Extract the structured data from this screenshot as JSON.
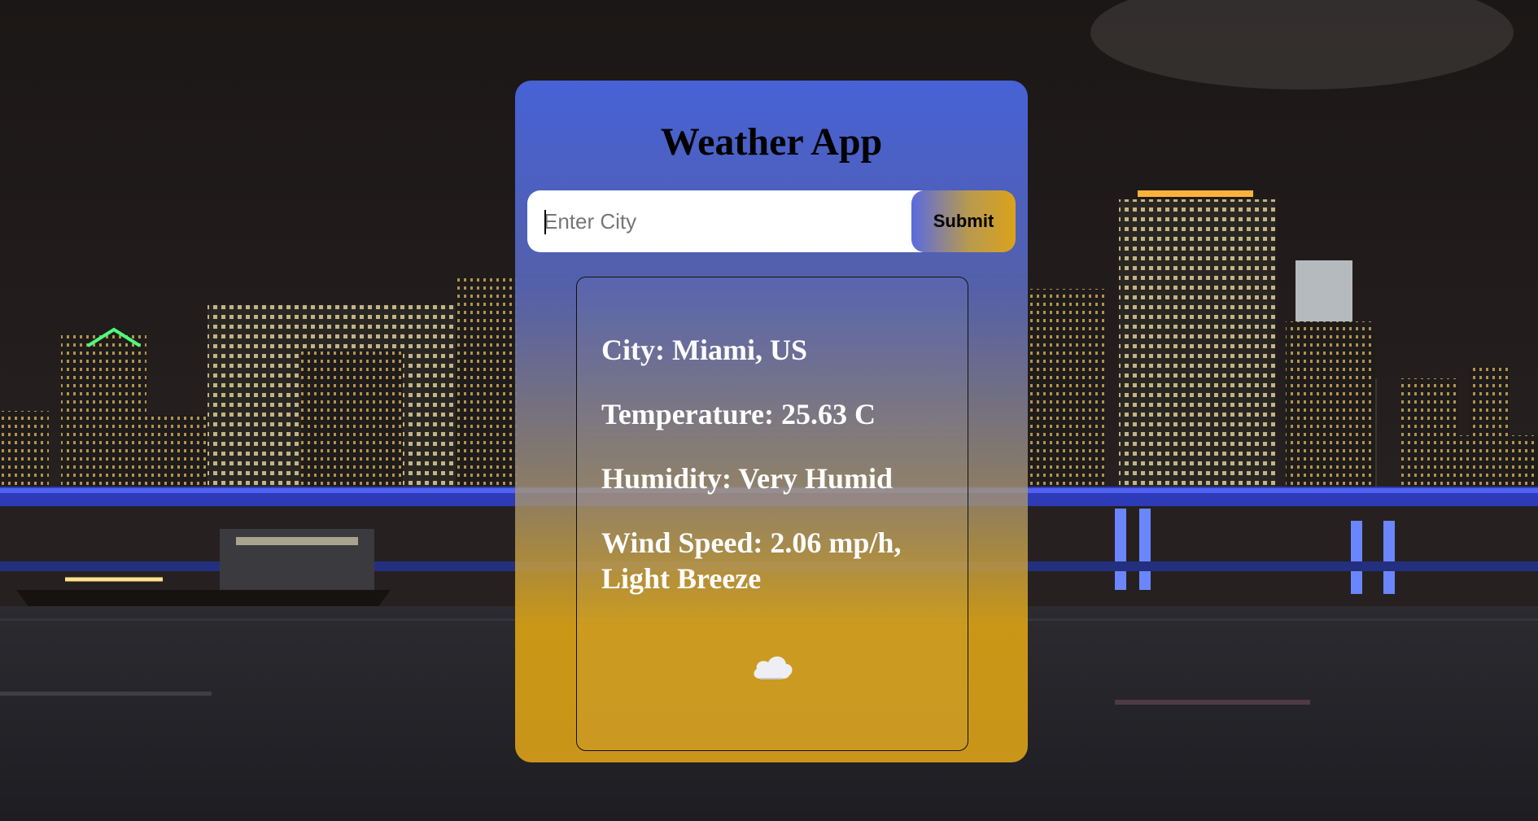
{
  "app": {
    "title": "Weather App"
  },
  "search": {
    "placeholder": "Enter City",
    "value": "",
    "submit_label": "Submit"
  },
  "weather": {
    "city_line": "City: Miami, US",
    "temperature_line": "Temperature: 25.63 C",
    "humidity_line": "Humidity: Very Humid",
    "wind_line": "Wind Speed: 2.06 mp/h, Light Breeze",
    "icon": "cloud-icon"
  },
  "colors": {
    "card_top": "#4a64dc",
    "card_bottom": "#d89b19",
    "text_light": "#ffffff",
    "title_text": "#000000"
  }
}
